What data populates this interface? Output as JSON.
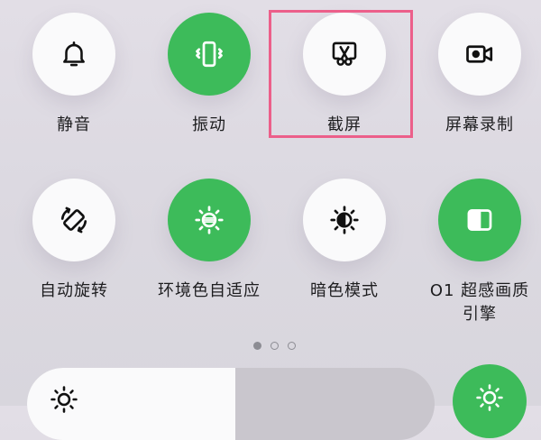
{
  "quick_settings": {
    "row1": [
      {
        "label": "静音",
        "state": "off",
        "icon": "bell-icon"
      },
      {
        "label": "振动",
        "state": "on",
        "icon": "vibrate-phone-icon"
      },
      {
        "label": "截屏",
        "state": "off",
        "icon": "screenshot-scissors-icon"
      },
      {
        "label": "屏幕录制",
        "state": "off",
        "icon": "video-camera-icon"
      }
    ],
    "row2": [
      {
        "label": "自动旋转",
        "state": "off",
        "icon": "auto-rotate-icon"
      },
      {
        "label": "环境色自适应",
        "state": "on",
        "icon": "adaptive-color-sun-icon"
      },
      {
        "label": "暗色模式",
        "state": "off",
        "icon": "dark-mode-icon"
      },
      {
        "label": "O1 超感画质引擎",
        "state": "on",
        "icon": "display-engine-icon"
      }
    ]
  },
  "pagination": {
    "pages": 3,
    "current": 1
  },
  "brightness": {
    "level": 0.51,
    "icon": "sun-icon"
  },
  "auto_brightness": {
    "state": "on",
    "icon": "sun-icon"
  },
  "highlight_target": "截屏",
  "colors": {
    "accent_green": "#3dbb5a",
    "tile_off": "#fafafb",
    "highlight_border": "#ec5f8a",
    "background": "#dedbe3"
  }
}
